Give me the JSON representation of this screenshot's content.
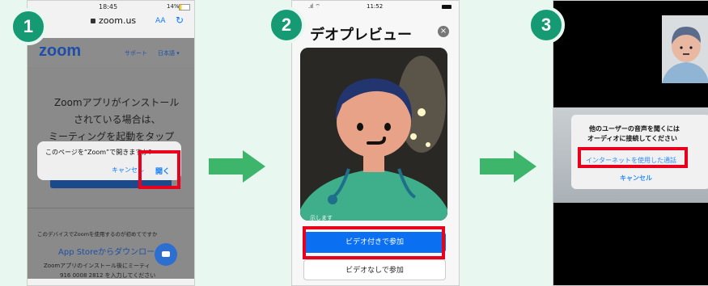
{
  "steps": [
    "1",
    "2",
    "3"
  ],
  "panel1": {
    "status_time": "18:45",
    "battery": "14%",
    "url": "zoom.us",
    "text_size": "AA",
    "logo": "zoom",
    "nav_support": "サポート",
    "nav_language": "日本語",
    "headline_line1": "Zoomアプリがインストール",
    "headline_line2": "されている場合は、",
    "headline_line3": "ミーティングを起動をタップ",
    "dialog_text": "このページを“Zoom”で開きますか?",
    "dialog_cancel": "キャンセル",
    "dialog_open": "開く",
    "first_time": "このデバイスでZoomを使用するのが初めてですか",
    "appstore": "App Storeからダウンロード",
    "install_note": "Zoomアプリのインストール後にミーティ",
    "meeting_id": "916 0008 2812 を入力してください"
  },
  "panel2": {
    "status_time": "11:52",
    "title": "デオプレビュー",
    "small_text": "示します",
    "join_with_video": "ビデオ付きで参加",
    "join_without_video": "ビデオなしで参加"
  },
  "panel3": {
    "dialog_line1": "他のユーザーの音声を聞くには",
    "dialog_line2": "オーディオに接続してください",
    "internet_audio": "インターネットを使用した通話",
    "cancel": "キャンセル"
  },
  "colors": {
    "accent_green": "#159a73",
    "arrow_green": "#3db56a",
    "highlight_red": "#e8001c",
    "ios_blue": "#0a7aff",
    "zoom_blue": "#2d8cff"
  }
}
